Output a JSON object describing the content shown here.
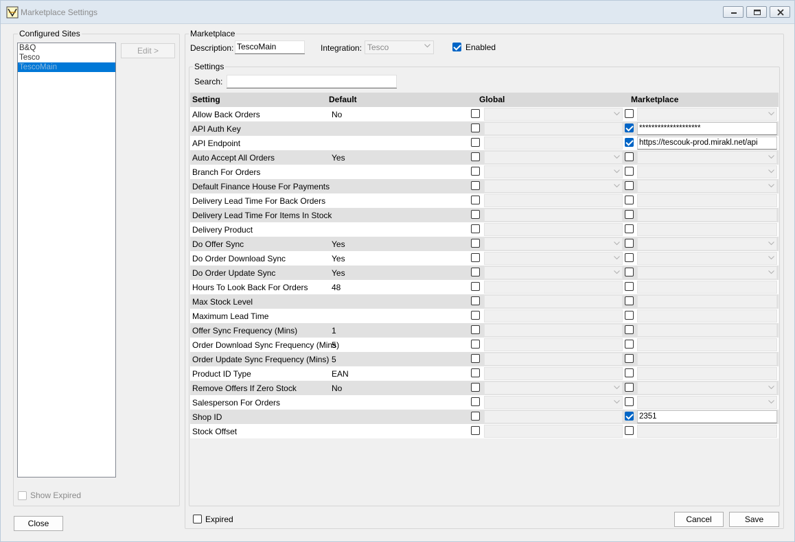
{
  "window": {
    "title": "Marketplace Settings"
  },
  "configured_sites": {
    "label": "Configured Sites",
    "items": [
      "B&Q",
      "Tesco",
      "TescoMain"
    ],
    "selected_index": 2,
    "edit_label": "Edit >",
    "show_expired_label": "Show Expired",
    "close_label": "Close"
  },
  "marketplace": {
    "group_label": "Marketplace",
    "description_label": "Description:",
    "description_value": "TescoMain",
    "integration_label": "Integration:",
    "integration_value": "Tesco",
    "enabled_label": "Enabled",
    "enabled": true
  },
  "settings": {
    "group_label": "Settings",
    "search_label": "Search:",
    "search_value": "",
    "columns": [
      "Setting",
      "Default",
      "Global",
      "Marketplace"
    ],
    "rows": [
      {
        "setting": "Allow Back Orders",
        "default": "No",
        "kind": "combo",
        "m_checked": false,
        "m_value": ""
      },
      {
        "setting": "API Auth Key",
        "default": "",
        "kind": "text",
        "m_checked": true,
        "m_value": "********************"
      },
      {
        "setting": "API Endpoint",
        "default": "",
        "kind": "text",
        "m_checked": true,
        "m_value": "https://tescouk-prod.mirakl.net/api"
      },
      {
        "setting": "Auto Accept All Orders",
        "default": "Yes",
        "kind": "combo",
        "m_checked": false,
        "m_value": ""
      },
      {
        "setting": "Branch For Orders",
        "default": "",
        "kind": "combo",
        "m_checked": false,
        "m_value": ""
      },
      {
        "setting": "Default Finance House For Payments",
        "default": "",
        "kind": "combo",
        "m_checked": false,
        "m_value": ""
      },
      {
        "setting": "Delivery Lead Time For Back Orders",
        "default": "",
        "kind": "text",
        "m_checked": false,
        "m_value": ""
      },
      {
        "setting": "Delivery Lead Time For Items In Stock",
        "default": "",
        "kind": "text",
        "m_checked": false,
        "m_value": ""
      },
      {
        "setting": "Delivery Product",
        "default": "",
        "kind": "text",
        "m_checked": false,
        "m_value": ""
      },
      {
        "setting": "Do Offer Sync",
        "default": "Yes",
        "kind": "combo",
        "m_checked": false,
        "m_value": ""
      },
      {
        "setting": "Do Order Download Sync",
        "default": "Yes",
        "kind": "combo",
        "m_checked": false,
        "m_value": ""
      },
      {
        "setting": "Do Order Update Sync",
        "default": "Yes",
        "kind": "combo",
        "m_checked": false,
        "m_value": ""
      },
      {
        "setting": "Hours To Look Back For Orders",
        "default": "48",
        "kind": "text",
        "m_checked": false,
        "m_value": ""
      },
      {
        "setting": "Max Stock Level",
        "default": "",
        "kind": "text",
        "m_checked": false,
        "m_value": ""
      },
      {
        "setting": "Maximum Lead Time",
        "default": "",
        "kind": "text",
        "m_checked": false,
        "m_value": ""
      },
      {
        "setting": "Offer Sync Frequency (Mins)",
        "default": "1",
        "kind": "text",
        "m_checked": false,
        "m_value": ""
      },
      {
        "setting": "Order Download Sync Frequency (Mins)",
        "default": "5",
        "kind": "text",
        "m_checked": false,
        "m_value": ""
      },
      {
        "setting": "Order Update Sync Frequency (Mins)",
        "default": "5",
        "kind": "text",
        "m_checked": false,
        "m_value": ""
      },
      {
        "setting": "Product ID Type",
        "default": "EAN",
        "kind": "text",
        "m_checked": false,
        "m_value": ""
      },
      {
        "setting": "Remove Offers If Zero Stock",
        "default": "No",
        "kind": "combo",
        "m_checked": false,
        "m_value": ""
      },
      {
        "setting": "Salesperson For Orders",
        "default": "",
        "kind": "combo",
        "m_checked": false,
        "m_value": ""
      },
      {
        "setting": "Shop ID",
        "default": "",
        "kind": "text",
        "m_checked": true,
        "m_value": "2351"
      },
      {
        "setting": "Stock Offset",
        "default": "",
        "kind": "text",
        "m_checked": false,
        "m_value": ""
      }
    ]
  },
  "footer": {
    "expired_label": "Expired",
    "cancel_label": "Cancel",
    "save_label": "Save"
  },
  "colors": {
    "selection": "#0078d7",
    "checkbox_checked": "#0065c6"
  }
}
